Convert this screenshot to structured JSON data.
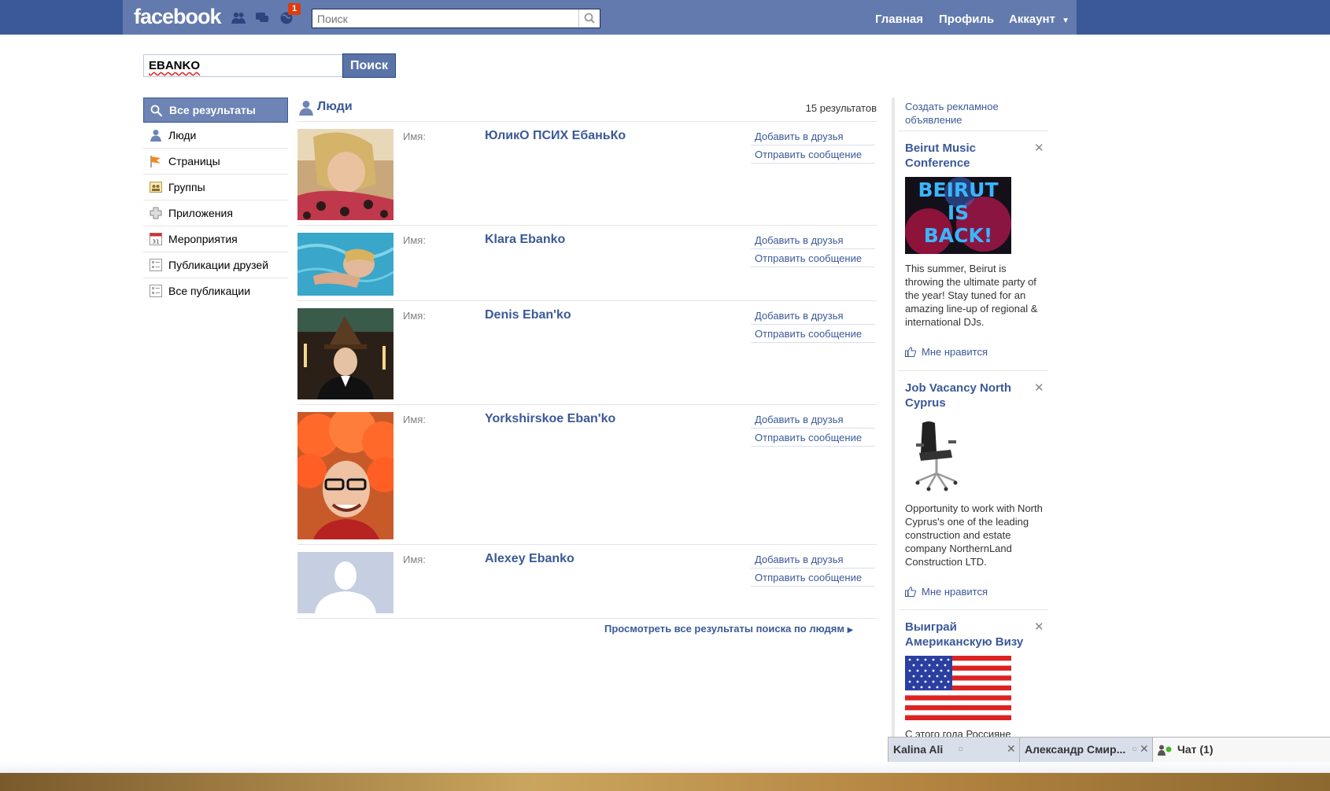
{
  "header": {
    "logo": "facebook",
    "notification_count": "1",
    "search_placeholder": "Поиск",
    "nav": [
      "Главная",
      "Профиль",
      "Аккаунт"
    ]
  },
  "query": {
    "value": "EBANKO",
    "button": "Поиск"
  },
  "filters": [
    {
      "label": "Все результаты",
      "icon": "magnifier-icon",
      "active": true
    },
    {
      "label": "Люди",
      "icon": "person-icon"
    },
    {
      "label": "Страницы",
      "icon": "flag-icon"
    },
    {
      "label": "Группы",
      "icon": "group-icon"
    },
    {
      "label": "Приложения",
      "icon": "puzzle-icon"
    },
    {
      "label": "Мероприятия",
      "icon": "calendar-icon"
    },
    {
      "label": "Публикации друзей",
      "icon": "post-icon"
    },
    {
      "label": "Все публикации",
      "icon": "post-icon"
    }
  ],
  "results": {
    "title": "Люди",
    "count": "15 результатов",
    "name_label": "Имя:",
    "add_friend": "Добавить в друзья",
    "send_message": "Отправить сообщение",
    "people": [
      {
        "name": "ЮликО ПСИХ ЕбаньКо"
      },
      {
        "name": "Klara Ebanko"
      },
      {
        "name": "Denis Eban'ko"
      },
      {
        "name": "Yorkshirskoe Eban'ko"
      },
      {
        "name": "Alexey Ebanko"
      }
    ],
    "see_all": "Просмотреть все результаты поиска по людям"
  },
  "ads": {
    "create_ad": "Создать рекламное объявление",
    "like_label": "Мне нравится",
    "items": [
      {
        "title": "Beirut Music Conference",
        "image_text": [
          "BEIRUT",
          "IS",
          "BACK!"
        ],
        "text": "This summer, Beirut is throwing the ultimate party of the year! Stay tuned for an amazing line-up of regional & international DJs."
      },
      {
        "title": "Job Vacancy North Cyprus",
        "text": "Opportunity to work with North Cyprus's one of the leading construction and estate company NorthernLand Construction LTD."
      },
      {
        "title": "Выиграй Американскую Визу",
        "text": "С этого года Россияне"
      }
    ]
  },
  "chat": {
    "tabs": [
      "Kalina Ali",
      "Александр Смир..."
    ],
    "main": "Чат (1)"
  },
  "colors": {
    "brand": "#3b5998",
    "brand_light": "#627aad",
    "badge": "#dd3c10"
  }
}
